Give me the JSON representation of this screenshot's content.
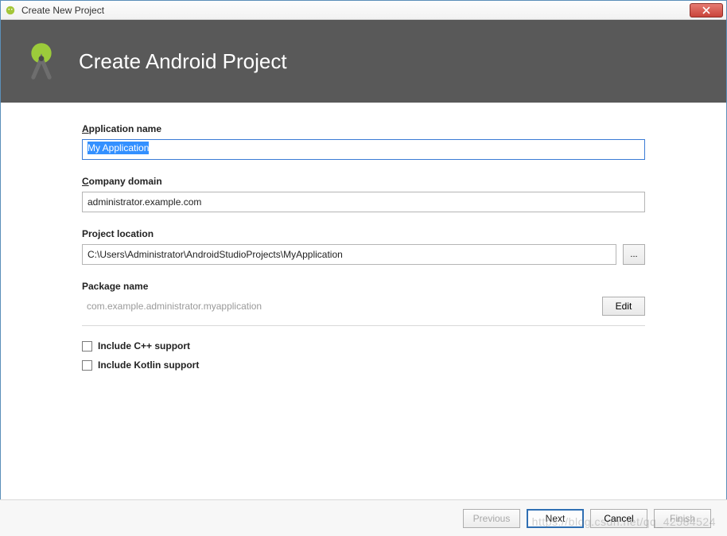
{
  "window": {
    "title": "Create New Project"
  },
  "banner": {
    "heading": "Create Android Project"
  },
  "fields": {
    "application_name": {
      "label_pre": "A",
      "label_rest": "pplication name",
      "value": "My Application"
    },
    "company_domain": {
      "label_pre": "C",
      "label_rest": "ompany domain",
      "value": "administrator.example.com"
    },
    "project_location": {
      "label": "Project location",
      "value": "C:\\Users\\Administrator\\AndroidStudioProjects\\MyApplication",
      "browse_label": "..."
    },
    "package_name": {
      "label": "Package name",
      "value": "com.example.administrator.myapplication",
      "edit_label": "Edit"
    }
  },
  "checkboxes": {
    "cpp": {
      "label": "Include C++ support",
      "checked": false
    },
    "kotlin": {
      "label": "Include Kotlin support",
      "checked": false
    }
  },
  "footer": {
    "previous": "Previous",
    "next": "Next",
    "cancel": "Cancel",
    "finish": "Finish"
  },
  "watermark": "https://blog.csdn.net/qq_42584524"
}
